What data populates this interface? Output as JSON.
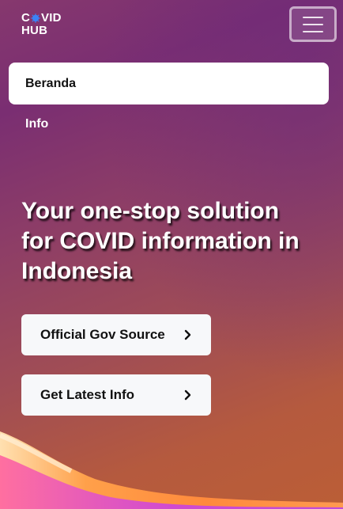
{
  "logo": {
    "line1_prefix": "C",
    "line1_suffix": "VID",
    "line2": "HUB",
    "icon": "virus-icon"
  },
  "header": {
    "menu_icon": "hamburger-icon"
  },
  "nav": {
    "items": [
      {
        "label": "Beranda",
        "active": true
      },
      {
        "label": "Info",
        "active": false
      }
    ]
  },
  "hero": {
    "title": "Your one-stop solution for COVID information in Indonesia"
  },
  "actions": [
    {
      "label": "Official Gov Source",
      "icon": "chevron-right-icon"
    },
    {
      "label": "Get Latest Info",
      "icon": "chevron-right-icon"
    }
  ],
  "colors": {
    "accent_blue": "#3b82f6",
    "button_bg": "#f7f8fa",
    "wave_orange": "#ff8a3c",
    "wave_magenta": "#c04bd8"
  }
}
